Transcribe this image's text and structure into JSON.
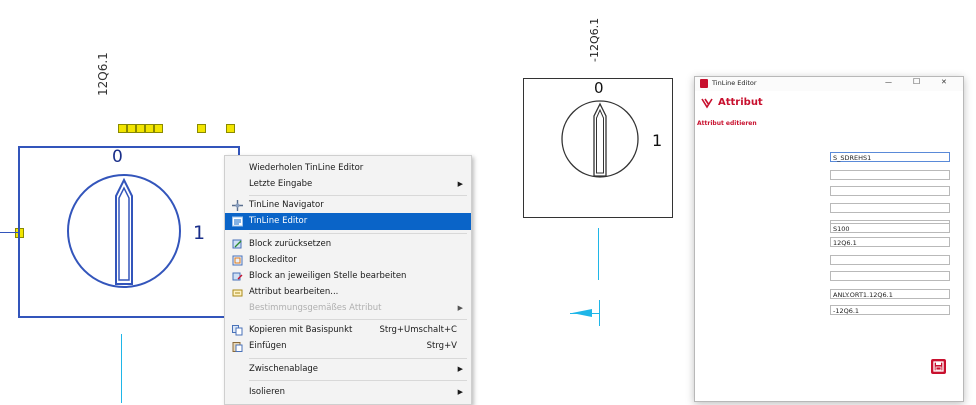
{
  "canvas_left": {
    "tag": "12Q6.1",
    "position_zero": "0",
    "position_one": "1"
  },
  "context_menu": {
    "items": [
      {
        "label": "Wiederholen TinLine Editor",
        "shortcut": "",
        "submenu": false,
        "icon": "none",
        "enabled": true,
        "highlighted": false
      },
      {
        "label": "Letzte Eingabe",
        "shortcut": "",
        "submenu": true,
        "icon": "none",
        "enabled": true,
        "highlighted": false
      },
      {
        "label": "TinLine Navigator",
        "shortcut": "",
        "submenu": false,
        "icon": "navigator-icon",
        "enabled": true,
        "highlighted": false
      },
      {
        "label": "TinLine Editor",
        "shortcut": "",
        "submenu": false,
        "icon": "editor-icon",
        "enabled": true,
        "highlighted": true
      },
      {
        "label": "Block zurücksetzen",
        "shortcut": "",
        "submenu": false,
        "icon": "block-reset-icon",
        "enabled": true,
        "highlighted": false
      },
      {
        "label": "Blockeditor",
        "shortcut": "",
        "submenu": false,
        "icon": "block-editor-icon",
        "enabled": true,
        "highlighted": false
      },
      {
        "label": "Block an jeweiligen Stelle bearbeiten",
        "shortcut": "",
        "submenu": false,
        "icon": "block-inplace-icon",
        "enabled": true,
        "highlighted": false
      },
      {
        "label": "Attribut bearbeiten...",
        "shortcut": "",
        "submenu": false,
        "icon": "attribute-edit-icon",
        "enabled": true,
        "highlighted": false
      },
      {
        "label": "Bestimmungsgemäßes Attribut",
        "shortcut": "",
        "submenu": true,
        "icon": "none",
        "enabled": false,
        "highlighted": false
      },
      {
        "label": "Kopieren mit Basispunkt",
        "shortcut": "Strg+Umschalt+C",
        "submenu": false,
        "icon": "copy-base-icon",
        "enabled": true,
        "highlighted": false
      },
      {
        "label": "Einfügen",
        "shortcut": "Strg+V",
        "submenu": false,
        "icon": "paste-icon",
        "enabled": true,
        "highlighted": false
      },
      {
        "label": "Zwischenablage",
        "shortcut": "",
        "submenu": true,
        "icon": "none",
        "enabled": true,
        "highlighted": false
      },
      {
        "label": "Isolieren",
        "shortcut": "",
        "submenu": true,
        "icon": "none",
        "enabled": true,
        "highlighted": false
      }
    ],
    "submenu_arrow": "▶"
  },
  "canvas_right": {
    "tag": "-12Q6.1",
    "position_zero": "0",
    "position_one": "1"
  },
  "dialog": {
    "title": "TinLine Editor",
    "header": "Attribut",
    "subheader": "Attribut editieren",
    "controls": {
      "minimize": "—",
      "maximize": "☐",
      "close": "✕"
    },
    "fields": [
      "S_SDREHS1",
      "",
      "",
      "",
      "",
      "S100",
      "12Q6.1",
      "",
      "",
      "ANLY.ORT1.12Q6.1",
      "-12Q6.1"
    ],
    "accent_color": "#c8102e"
  },
  "colors": {
    "symbol_blue": "#3355bb",
    "cyan_line": "#1fb6e8",
    "grip_yellow": "#f2e500",
    "highlight_blue": "#0a64c8"
  }
}
